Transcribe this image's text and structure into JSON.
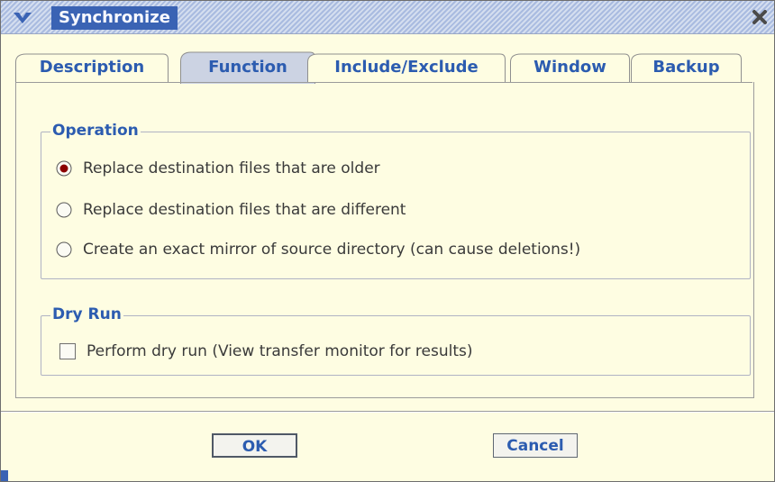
{
  "window": {
    "title": "Synchronize"
  },
  "tabs": [
    {
      "label": "Description",
      "selected": false
    },
    {
      "label": "Function",
      "selected": true
    },
    {
      "label": "Include/Exclude",
      "selected": false
    },
    {
      "label": "Window",
      "selected": false
    },
    {
      "label": "Backup",
      "selected": false
    }
  ],
  "operation": {
    "title": "Operation",
    "options": [
      {
        "label": "Replace destination files that are older",
        "checked": true
      },
      {
        "label": "Replace destination files that are different",
        "checked": false
      },
      {
        "label": "Create an exact mirror of source directory (can cause deletions!)",
        "checked": false
      }
    ]
  },
  "dry_run": {
    "title": "Dry Run",
    "checkbox_label": "Perform dry run (View transfer monitor for results)",
    "checked": false
  },
  "buttons": {
    "ok": "OK",
    "cancel": "Cancel"
  },
  "icons": {
    "menu": "chevron-down-icon",
    "close": "close-icon"
  },
  "colors": {
    "background": "#fefde2",
    "title_bar": "#3a63b4",
    "accent_text": "#2c5cb0",
    "radio_selected": "#8b0000",
    "selected_tab": "#ccd3e3"
  }
}
